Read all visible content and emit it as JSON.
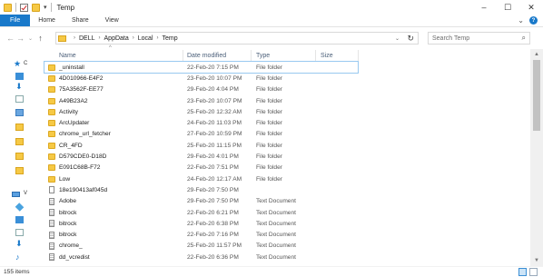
{
  "window": {
    "title": "Temp"
  },
  "ribbon": {
    "tabs": [
      "File",
      "Home",
      "Share",
      "View"
    ]
  },
  "address": {
    "crumbs": [
      "DELL",
      "AppData",
      "Local",
      "Temp"
    ],
    "search_placeholder": "Search Temp"
  },
  "nav": {
    "label_c": "C",
    "label_v": "V"
  },
  "columns": {
    "name": "Name",
    "date": "Date modified",
    "type": "Type",
    "size": "Size"
  },
  "files": [
    {
      "name": "_uninstall",
      "date": "22-Feb-20 7:15 PM",
      "type": "File folder",
      "icon": "folder"
    },
    {
      "name": "4D010966-E4F2",
      "date": "23-Feb-20 10:07 PM",
      "type": "File folder",
      "icon": "folder"
    },
    {
      "name": "75A3562F-EE77",
      "date": "29-Feb-20 4:04 PM",
      "type": "File folder",
      "icon": "folder"
    },
    {
      "name": "A49B23A2",
      "date": "23-Feb-20 10:07 PM",
      "type": "File folder",
      "icon": "folder"
    },
    {
      "name": "Activity",
      "date": "25-Feb-20 12:32 AM",
      "type": "File folder",
      "icon": "folder"
    },
    {
      "name": "ArcUpdater",
      "date": "24-Feb-20 11:03 PM",
      "type": "File folder",
      "icon": "folder"
    },
    {
      "name": "chrome_url_fetcher",
      "date": "27-Feb-20 10:59 PM",
      "type": "File folder",
      "icon": "folder"
    },
    {
      "name": "CR_4FD",
      "date": "25-Feb-20 11:15 PM",
      "type": "File folder",
      "icon": "folder"
    },
    {
      "name": "D579CDE0-D18D",
      "date": "29-Feb-20 4:01 PM",
      "type": "File folder",
      "icon": "folder"
    },
    {
      "name": "E091C68B-F72",
      "date": "22-Feb-20 7:51 PM",
      "type": "File folder",
      "icon": "folder"
    },
    {
      "name": "Low",
      "date": "24-Feb-20 12:17 AM",
      "type": "File folder",
      "icon": "folder"
    },
    {
      "name": "18e190413af045d",
      "date": "29-Feb-20 7:50 PM",
      "type": "",
      "icon": "file"
    },
    {
      "name": "Adobe",
      "date": "29-Feb-20 7:50 PM",
      "type": "Text Document",
      "icon": "text"
    },
    {
      "name": "bitrock",
      "date": "22-Feb-20 6:21 PM",
      "type": "Text Document",
      "icon": "text"
    },
    {
      "name": "bitrock",
      "date": "22-Feb-20 6:38 PM",
      "type": "Text Document",
      "icon": "text"
    },
    {
      "name": "bitrock",
      "date": "22-Feb-20 7:16 PM",
      "type": "Text Document",
      "icon": "text"
    },
    {
      "name": "chrome_",
      "date": "25-Feb-20 11:57 PM",
      "type": "Text Document",
      "icon": "text"
    },
    {
      "name": "dd_vcredist",
      "date": "22-Feb-20 6:36 PM",
      "type": "Text Document",
      "icon": "text"
    }
  ],
  "status": {
    "item_count": "155 items"
  }
}
